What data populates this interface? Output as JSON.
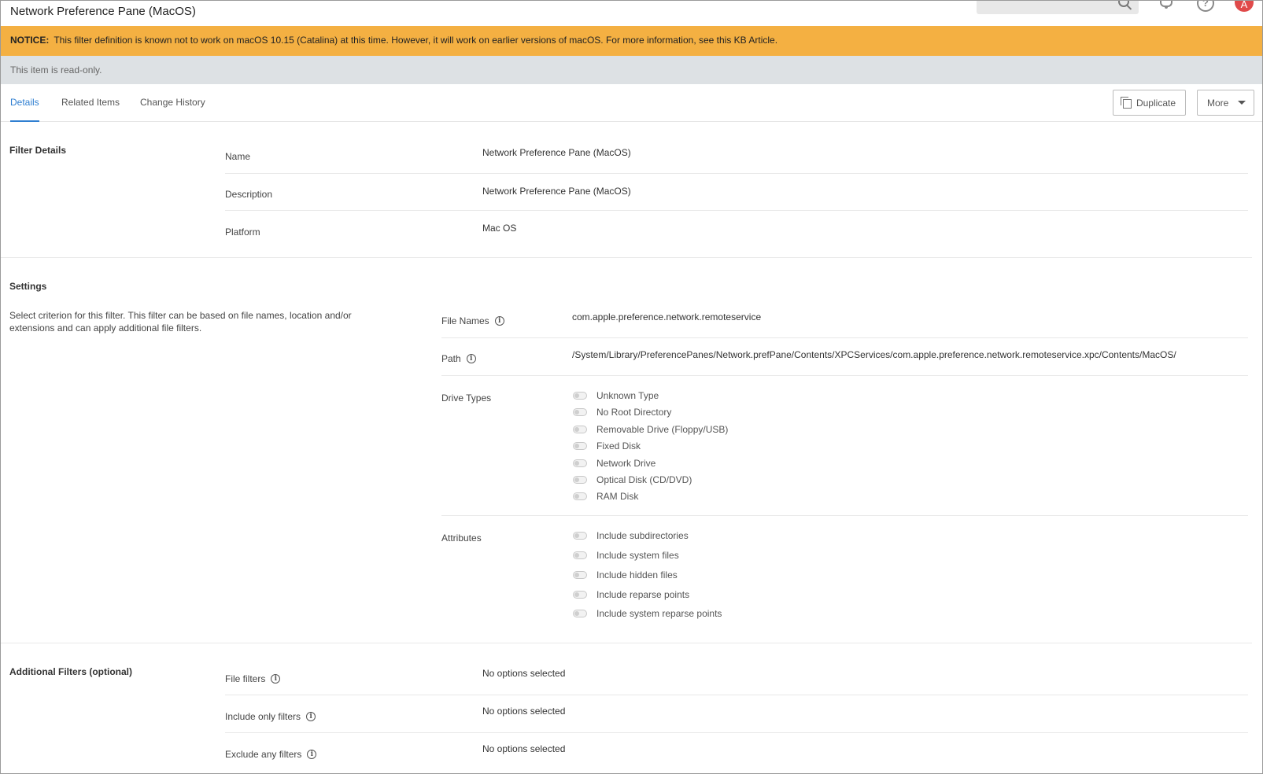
{
  "header": {
    "title": "Network Preference Pane (MacOS)",
    "help_glyph": "?",
    "avatar_letter": "A"
  },
  "notice": {
    "label": "NOTICE:",
    "text": "This filter definition is known not to work on macOS 10.15 (Catalina) at this time. However, it will work on earlier versions of macOS. For more information, see this KB Article."
  },
  "readonly_text": "This item is read-only.",
  "tabs": [
    {
      "label": "Details",
      "active": true
    },
    {
      "label": "Related Items",
      "active": false
    },
    {
      "label": "Change History",
      "active": false
    }
  ],
  "actions": {
    "duplicate_label": "Duplicate",
    "more_label": "More"
  },
  "filter_details": {
    "title": "Filter Details",
    "fields": [
      {
        "label": "Name",
        "value": "Network Preference Pane (MacOS)"
      },
      {
        "label": "Description",
        "value": "Network Preference Pane (MacOS)"
      },
      {
        "label": "Platform",
        "value": "Mac OS"
      }
    ]
  },
  "settings": {
    "title": "Settings",
    "description": "Select criterion for this filter. This filter can be based on file names, location and/or extensions and can apply additional file filters.",
    "file_names_label": "File Names",
    "file_names_value": "com.apple.preference.network.remoteservice",
    "path_label": "Path",
    "path_value": "/System/Library/PreferencePanes/Network.prefPane/Contents/XPCServices/com.apple.preference.network.remoteservice.xpc/Contents/MacOS/",
    "drive_types_label": "Drive Types",
    "drive_types": [
      "Unknown Type",
      "No Root Directory",
      "Removable Drive (Floppy/USB)",
      "Fixed Disk",
      "Network Drive",
      "Optical Disk (CD/DVD)",
      "RAM Disk"
    ],
    "attributes_label": "Attributes",
    "attributes": [
      "Include subdirectories",
      "Include system files",
      "Include hidden files",
      "Include reparse points",
      "Include system reparse points"
    ]
  },
  "additional_filters": {
    "title": "Additional Filters (optional)",
    "fields": [
      {
        "label": "File filters",
        "value": "No options selected"
      },
      {
        "label": "Include only filters",
        "value": "No options selected"
      },
      {
        "label": "Exclude any filters",
        "value": "No options selected"
      }
    ]
  },
  "info_glyph": "i",
  "colors": {
    "notice_bg": "#f4b042",
    "readonly_bg": "#dde1e4",
    "accent": "#2f7fd1",
    "avatar_bg": "#e04a4a"
  }
}
